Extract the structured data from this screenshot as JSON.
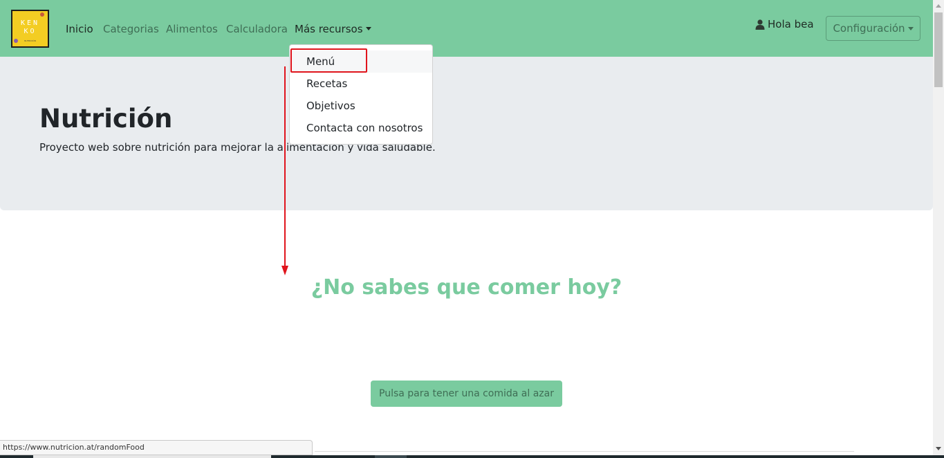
{
  "brand": {
    "logo_text": "KEN\nKO",
    "logo_subtext": "NUTRICIÓN"
  },
  "nav": {
    "items": [
      {
        "label": "Inicio"
      },
      {
        "label": "Categorias"
      },
      {
        "label": "Alimentos"
      },
      {
        "label": "Calculadora"
      },
      {
        "label": "Más recursos"
      }
    ]
  },
  "user": {
    "greeting": "Hola bea",
    "icon": "user-icon"
  },
  "config": {
    "label": "Configuración"
  },
  "dropdown": {
    "items": [
      {
        "label": "Menú"
      },
      {
        "label": "Recetas"
      },
      {
        "label": "Objetivos"
      },
      {
        "label": "Contacta con nosotros"
      }
    ]
  },
  "hero": {
    "title": "Nutrición",
    "subtitle": "Proyecto web sobre nutrición para mejorar la alimentación y vida saludable."
  },
  "random": {
    "question": "¿No sabes que comer hoy?",
    "button_label": "Pulsa para tener una comida al azar"
  },
  "status_bar": {
    "url": "https://www.nutricion.at/randomFood"
  },
  "colors": {
    "brand_green": "#7acb9f",
    "annotation_red": "#e0141c",
    "logo_yellow": "#f3cd23"
  }
}
